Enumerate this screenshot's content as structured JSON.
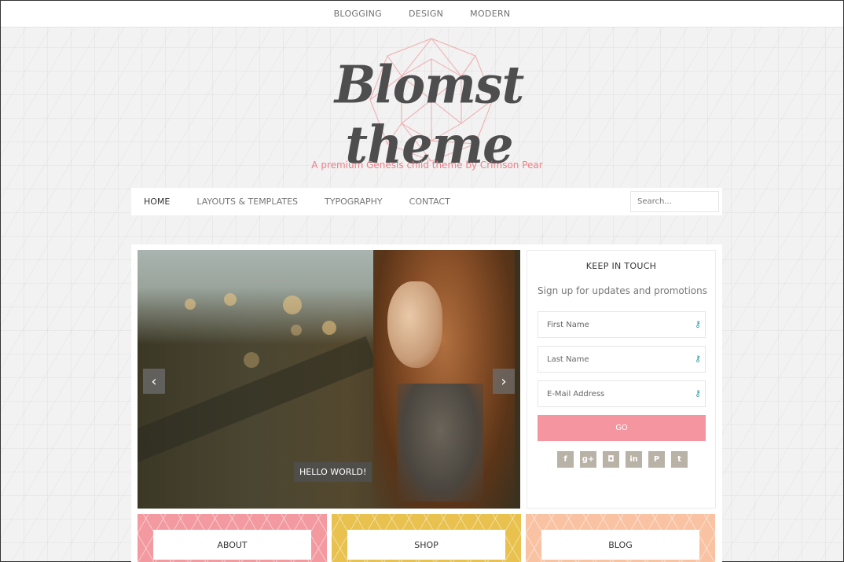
{
  "top_nav": {
    "items": [
      "BLOGGING",
      "DESIGN",
      "MODERN"
    ]
  },
  "header": {
    "title": "Blomst theme",
    "tagline": "A premium Genesis child theme by Crimson Pear",
    "accent_color": "#ef7f8a"
  },
  "main_nav": {
    "items": [
      "HOME",
      "LAYOUTS & TEMPLATES",
      "TYPOGRAPHY",
      "CONTACT"
    ],
    "active": "HOME",
    "search_placeholder": "Search..."
  },
  "slider": {
    "caption": "HELLO WORLD!",
    "prev_icon": "chevron-left-icon",
    "next_icon": "chevron-right-icon"
  },
  "newsletter": {
    "title": "KEEP IN TOUCH",
    "subtitle": "Sign up for updates and promotions",
    "fields": [
      {
        "placeholder": "First Name"
      },
      {
        "placeholder": "Last Name"
      },
      {
        "placeholder": "E-Mail Address"
      }
    ],
    "submit_label": "GO",
    "submit_color": "#f4959f",
    "social": [
      {
        "name": "facebook",
        "glyph": "f"
      },
      {
        "name": "google-plus",
        "glyph": "g+"
      },
      {
        "name": "instagram",
        "glyph": "◘"
      },
      {
        "name": "linkedin",
        "glyph": "in"
      },
      {
        "name": "pinterest",
        "glyph": "P"
      },
      {
        "name": "twitter",
        "glyph": "t"
      }
    ]
  },
  "tiles": [
    {
      "label": "ABOUT",
      "color": "#f29aa0"
    },
    {
      "label": "SHOP",
      "color": "#e8c14e"
    },
    {
      "label": "BLOG",
      "color": "#f9c3a3"
    }
  ]
}
